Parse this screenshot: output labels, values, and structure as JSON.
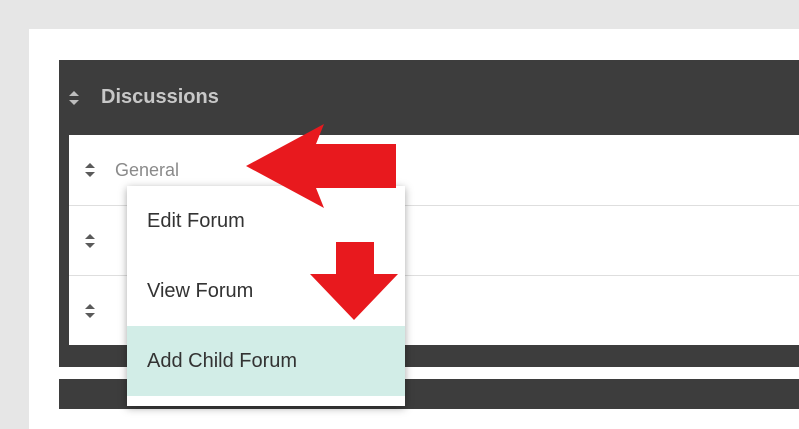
{
  "category": {
    "title": "Discussions",
    "icon": "sort-icon"
  },
  "forums": [
    {
      "name": "General",
      "icon": "sort-icon"
    },
    {
      "name": "",
      "icon": "sort-icon"
    },
    {
      "name": "",
      "icon": "sort-icon"
    }
  ],
  "context_menu": {
    "items": [
      {
        "label": "Edit Forum"
      },
      {
        "label": "View Forum"
      },
      {
        "label": "Add Child Forum",
        "highlighted": true
      }
    ]
  },
  "annotations": {
    "arrow_color": "#e8191e",
    "icons": [
      "left-arrow-annotation",
      "down-arrow-annotation"
    ]
  },
  "colors": {
    "header_bg": "#3d3d3d",
    "highlight_bg": "#d2ede7"
  }
}
